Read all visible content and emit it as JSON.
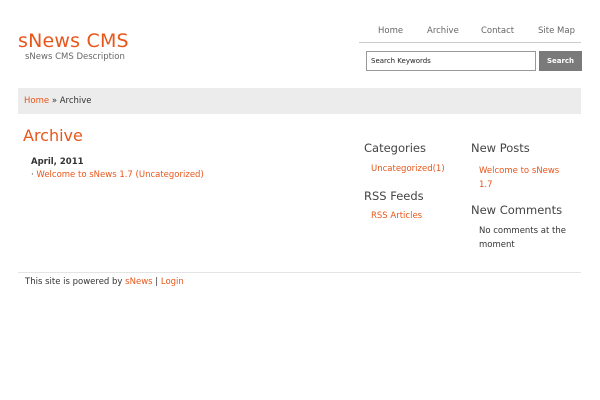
{
  "header": {
    "site_title": "sNews CMS",
    "site_description": "sNews CMS Description"
  },
  "nav": {
    "items": [
      {
        "label": "Home"
      },
      {
        "label": "Archive"
      },
      {
        "label": "Contact"
      },
      {
        "label": "Site Map"
      }
    ]
  },
  "search": {
    "value": "Search Keywords",
    "button_label": "Search"
  },
  "breadcrumb": {
    "home": "Home",
    "separator": "»",
    "current": "Archive"
  },
  "main": {
    "title": "Archive",
    "month": "April, 2011",
    "entry_bullet": "·",
    "entry_link": "Welcome to sNews 1.7 (Uncategorized)"
  },
  "sidebar_left": {
    "categories_heading": "Categories",
    "categories": [
      {
        "label": "Uncategorized(1)"
      }
    ],
    "rss_heading": "RSS Feeds",
    "rss_link": "RSS Articles"
  },
  "sidebar_right": {
    "new_posts_heading": "New Posts",
    "new_posts": [
      {
        "label": "Welcome to sNews 1.7"
      }
    ],
    "new_comments_heading": "New Comments",
    "new_comments_text": "No comments at the moment"
  },
  "footer": {
    "text": "This site is powered by",
    "snews_link": "sNews",
    "separator": "|",
    "login_link": "Login"
  },
  "colors": {
    "accent": "#e8561a",
    "breadcrumb_bg": "#ececec",
    "search_button_bg": "#7a7a7a"
  }
}
